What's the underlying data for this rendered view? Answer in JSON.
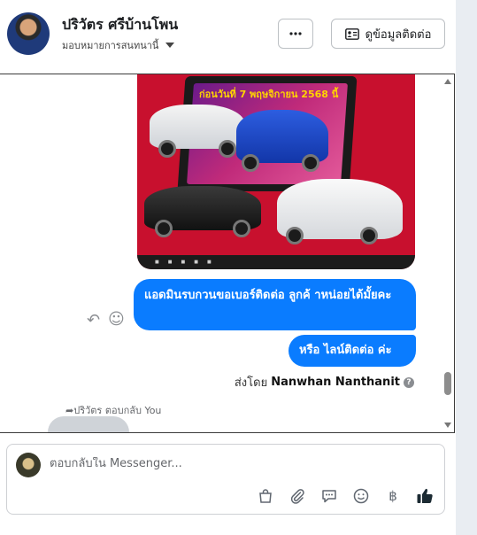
{
  "header": {
    "contact_name": "ปริวัตร ศรีบ้านโพน",
    "assign_label": "มอบหมายการสนทนานี้",
    "more_button_label": "···",
    "contact_info_button_label": "ดูข้อมูลติดต่อ"
  },
  "chat": {
    "ad_image": {
      "banner_text": "ก่อนวันที่ 7 พฤษจิกายน 2568 นี้"
    },
    "messages": [
      {
        "sender": "page",
        "text": "แอดมินรบกวนขอเบอร์ติดต่อ ลูกค้ าหน่อยได้มั้ยคะ"
      },
      {
        "sender": "page",
        "text": "หรือ ไลน์ติดต่อ ค่ะ"
      }
    ],
    "sent_by_prefix": "ส่งโดย",
    "sent_by_name": "Nanwhan Nanthanit",
    "replied_text": "ปริวัตร ตอบกลับ You"
  },
  "composer": {
    "placeholder": "ตอบกลับใน Messenger..."
  },
  "colors": {
    "accent": "#0a7cff",
    "ad_background": "#c8102e"
  },
  "icons": {
    "more": "more-dots-icon",
    "contact": "contact-card-icon",
    "reply": "reply-arrow-icon",
    "react": "smiley-icon",
    "info": "info-icon",
    "bag": "shopping-bag-icon",
    "attach": "paperclip-icon",
    "saved_reply": "chat-bubble-icon",
    "emoji": "emoji-icon",
    "payment": "baht-icon",
    "like": "thumbs-up-icon"
  }
}
